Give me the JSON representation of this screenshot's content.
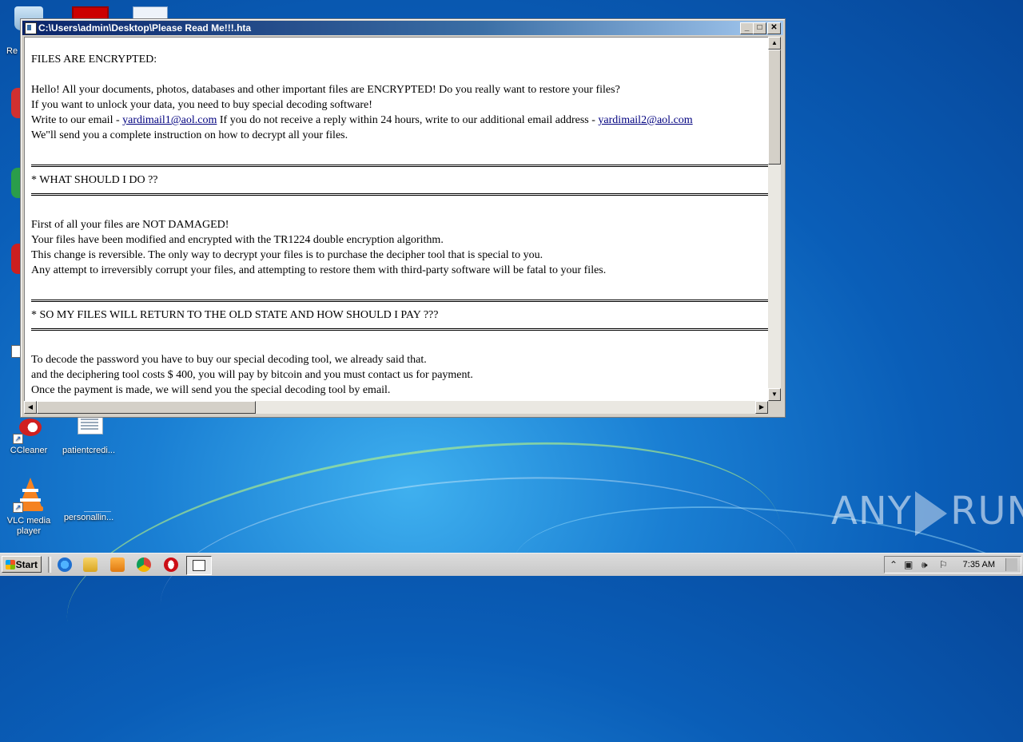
{
  "window": {
    "title": "C:\\Users\\admin\\Desktop\\Please Read Me!!!.hta",
    "buttons": {
      "minimize": "_",
      "maximize": "□",
      "close": "✕"
    }
  },
  "note": {
    "header": "FILES ARE ENCRYPTED:",
    "intro": {
      "line1": "Hello! All your documents, photos, databases and other important files are ENCRYPTED! Do you really want to restore your files?",
      "line2": "If you want to unlock your data, you need to buy special decoding software!",
      "line3_prefix": "Write to our email - ",
      "email1": "yardimail1@aol.com",
      "line3_middle": " If you do not receive a reply within 24 hours, write to our additional email address - ",
      "email2": "yardimail2@aol.com",
      "line4": "We\"ll send you a complete instruction on how to decrypt all your files."
    },
    "section1": {
      "heading": "* WHAT SHOULD I DO ??",
      "lines": [
        "First of all your files are NOT DAMAGED!",
        "Your files have been modified and encrypted with the TR1224 double encryption algorithm.",
        "This change is reversible. The only way to decrypt your files is to purchase the decipher tool that is special to you.",
        "Any attempt to irreversibly corrupt your files, and attempting to restore them with third-party software will be fatal to your files."
      ]
    },
    "section2": {
      "heading": "* SO MY FILES WILL RETURN TO THE OLD STATE AND HOW SHOULD I PAY ???",
      "lines": [
        "To decode the password you have to buy our special decoding tool, we already said that.",
        "and the deciphering tool costs $ 400, you will pay by bitcoin and you must contact us for payment.",
        "Once the payment is made, we will send you the special decoding tool by email."
      ]
    }
  },
  "desktop": {
    "partial_label": "Re",
    "icons": {
      "ccleaner": "CCleaner",
      "patientcredi": "patientcredi...",
      "vlc": "VLC media player",
      "personallin": "personallin..."
    }
  },
  "watermark": {
    "left": "ANY",
    "right": "RUN"
  },
  "taskbar": {
    "start_label": "Start",
    "clock": "7:35 AM"
  }
}
